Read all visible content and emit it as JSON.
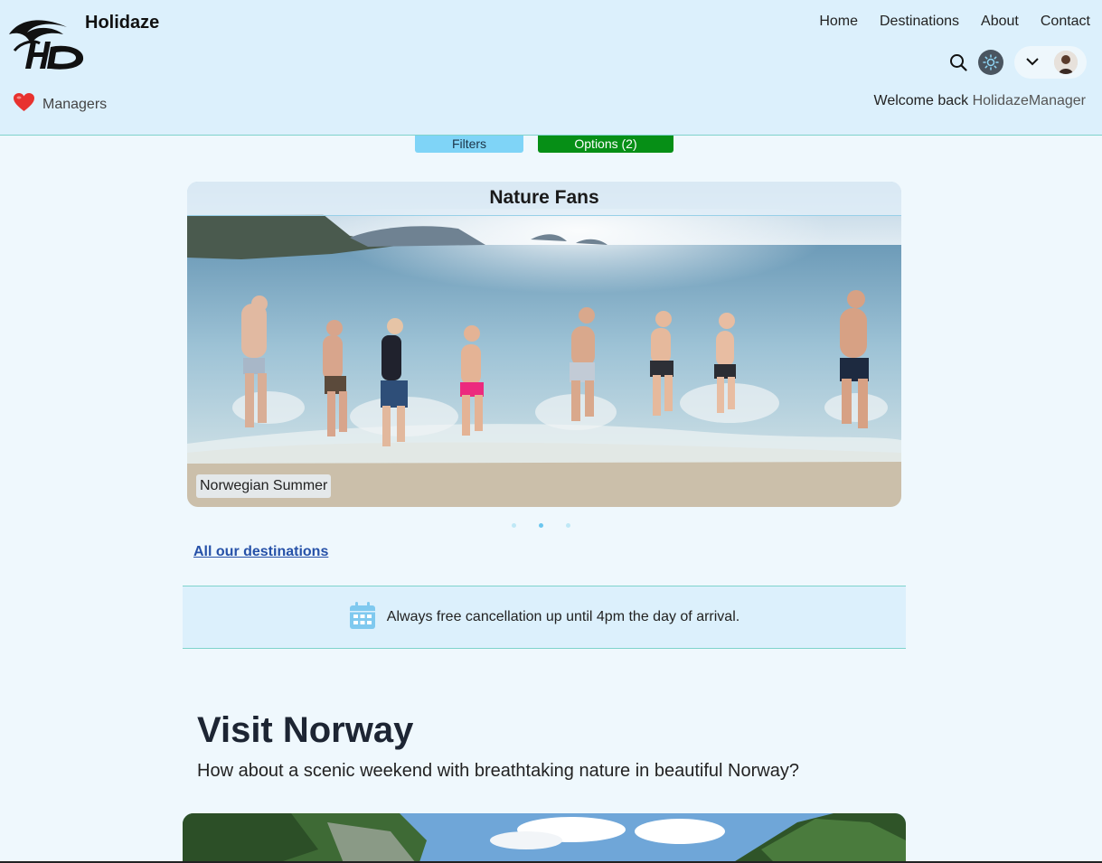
{
  "brand": {
    "name": "Holidaze",
    "logo_icon": "hd-logo-icon"
  },
  "nav": {
    "home": "Home",
    "destinations": "Destinations",
    "about": "About",
    "contact": "Contact"
  },
  "managers": {
    "label": "Managers",
    "icon": "heart-icon"
  },
  "welcome": {
    "prefix": "Welcome back",
    "username": "HolidazeManager"
  },
  "buttons": {
    "filters": "Filters",
    "options": "Options (2)"
  },
  "carousel": {
    "title": "Nature Fans",
    "caption": "Norwegian Summer",
    "active_index": 1,
    "slide_count": 3
  },
  "links": {
    "all_destinations": "All our destinations"
  },
  "notice": {
    "text": "Always free cancellation up until 4pm the day of arrival.",
    "icon": "calendar-icon"
  },
  "section": {
    "title": "Visit Norway",
    "subtitle": "How about a scenic weekend with breathtaking nature in beautiful Norway?"
  },
  "colors": {
    "header_bg": "#dcf0fc",
    "page_bg": "#eff8fd",
    "filters_btn": "#7fd4f7",
    "options_btn": "#068f16",
    "link": "#2651a8",
    "heart": "#e8322f"
  }
}
